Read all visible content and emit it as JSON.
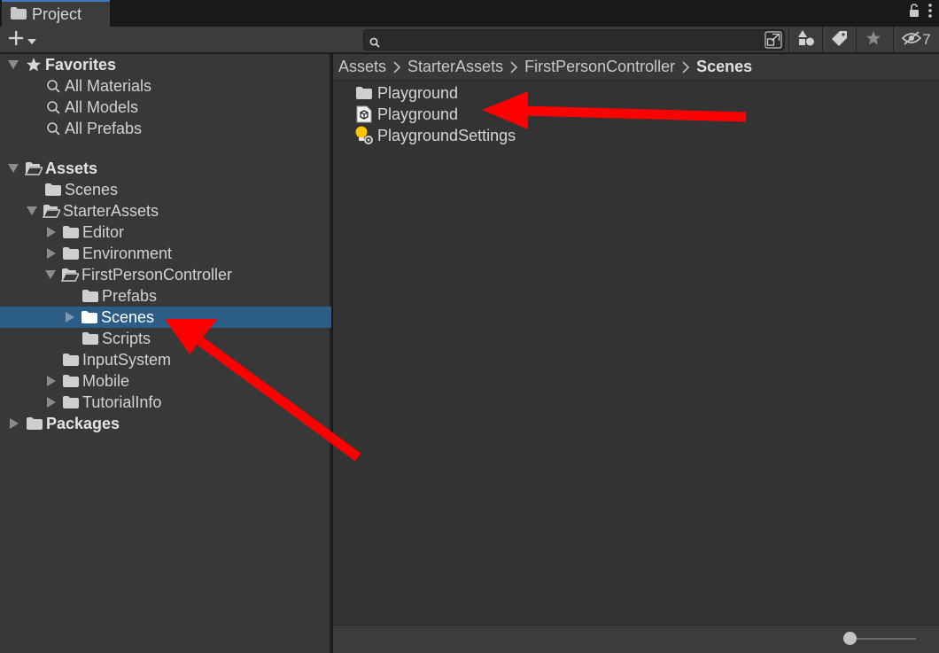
{
  "window": {
    "tab_label": "Project",
    "hidden_count": "7"
  },
  "search": {
    "value": "",
    "placeholder": ""
  },
  "favorites": {
    "label": "Favorites",
    "items": [
      {
        "label": "All Materials"
      },
      {
        "label": "All Models"
      },
      {
        "label": "All Prefabs"
      }
    ]
  },
  "tree": {
    "assets": "Assets",
    "scenes_root": "Scenes",
    "starter_assets": "StarterAssets",
    "editor": "Editor",
    "environment": "Environment",
    "fpc": "FirstPersonController",
    "prefabs": "Prefabs",
    "scenes": "Scenes",
    "scripts": "Scripts",
    "input_system": "InputSystem",
    "mobile": "Mobile",
    "tutorial_info": "TutorialInfo",
    "packages": "Packages"
  },
  "breadcrumb": [
    "Assets",
    "StarterAssets",
    "FirstPersonController",
    "Scenes"
  ],
  "assets": [
    {
      "label": "Playground",
      "icon": "folder-icon"
    },
    {
      "label": "Playground",
      "icon": "scene-icon"
    },
    {
      "label": "PlaygroundSettings",
      "icon": "lighting-settings-icon"
    }
  ],
  "zoom": {
    "value": 0
  },
  "colors": {
    "selection": "#2c5d87",
    "annotation_arrow": "#ff0000",
    "panel": "#383838",
    "content": "#333333"
  }
}
